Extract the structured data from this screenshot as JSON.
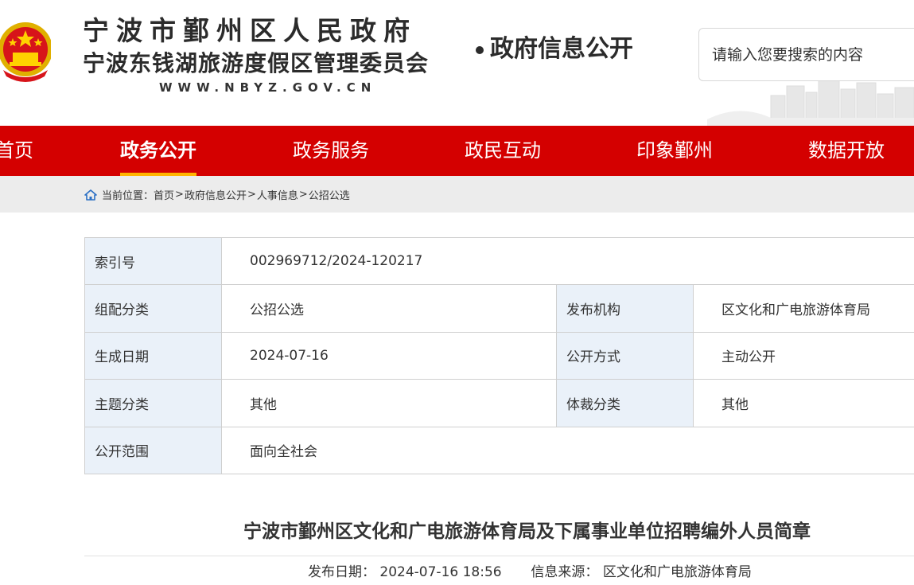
{
  "header": {
    "site_title": "宁波市鄞州区人民政府",
    "site_subtitle": "宁波东钱湖旅游度假区管理委员会",
    "site_url": "WWW.NBYZ.GOV.CN",
    "section_tag": "政府信息公开",
    "emblem_icon": "national-emblem-icon",
    "search": {
      "placeholder": "请输入您要搜索的内容",
      "value": ""
    }
  },
  "nav": {
    "items": [
      {
        "label": "首页",
        "active": false
      },
      {
        "label": "政务公开",
        "active": true
      },
      {
        "label": "政务服务",
        "active": false
      },
      {
        "label": "政民互动",
        "active": false
      },
      {
        "label": "印象鄞州",
        "active": false
      },
      {
        "label": "数据开放",
        "active": false
      }
    ],
    "colors": {
      "background": "#d40000",
      "active_underline": "#ffb400"
    }
  },
  "breadcrumb": {
    "prefix": "当前位置：",
    "items": [
      "首页",
      "政府信息公开",
      "人事信息",
      "公招公选"
    ],
    "separator": ">",
    "icon": "home-icon"
  },
  "meta": {
    "index_label": "索引号",
    "index_value": "002969712/2024-120217",
    "category_label": "组配分类",
    "category_value": "公招公选",
    "publisher_label": "发布机构",
    "publisher_value": "区文化和广电旅游体育局",
    "date_label": "生成日期",
    "date_value": "2024-07-16",
    "method_label": "公开方式",
    "method_value": "主动公开",
    "topic_label": "主题分类",
    "topic_value": "其他",
    "genre_label": "体裁分类",
    "genre_value": "其他",
    "scope_label": "公开范围",
    "scope_value": "面向全社会"
  },
  "article": {
    "title": "宁波市鄞州区文化和广电旅游体育局及下属事业单位招聘编外人员简章",
    "date_label": "发布日期：",
    "date_value": "2024-07-16 18:56",
    "source_label": "信息来源：",
    "source_value": "区文化和广电旅游体育局"
  }
}
